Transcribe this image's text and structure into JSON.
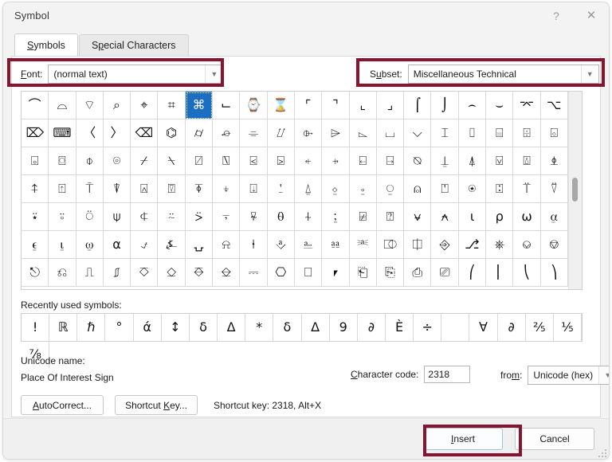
{
  "window": {
    "title": "Symbol",
    "help_icon": "question-mark-icon",
    "close_icon": "close-x-icon"
  },
  "tabs": [
    {
      "label": "Symbols",
      "accel": "S",
      "active": true
    },
    {
      "label": "Special Characters",
      "accel": "p",
      "active": false
    }
  ],
  "font_selector": {
    "label": "Font:",
    "accel": "F",
    "value": "(normal text)",
    "arrow_icon": "chevron-down-icon",
    "highlighted": true
  },
  "subset_selector": {
    "label": "Subset:",
    "accel": "u",
    "value": "Miscellaneous Technical",
    "arrow_icon": "chevron-down-icon",
    "highlighted": true
  },
  "symbol_grid": {
    "columns": 20,
    "rows": 7,
    "selected_index": 6,
    "selected_char": "⌘",
    "cells": [
      "⌒",
      "⌓",
      "⌔",
      "⌕",
      "⌖",
      "⌗",
      "⌘",
      "⌙",
      "⌚",
      "⌛",
      "⌜",
      "⌝",
      "⌞",
      "⌟",
      "⌠",
      "⌡",
      "⌢",
      "⌣",
      "⌤",
      "⌥",
      "⌦",
      "⌨",
      "〈",
      "〉",
      "⌫",
      "⌬",
      "⌭",
      "⌮",
      "⌯",
      "⌰",
      "⌱",
      "⌲",
      "⌳",
      "⌴",
      "⌵",
      "⌶",
      "⌷",
      "⌸",
      "⌹",
      "⌺",
      "⌻",
      "⌼",
      "⌽",
      "⌾",
      "⌿",
      "⍀",
      "⍁",
      "⍂",
      "⍃",
      "⍄",
      "⍅",
      "⍆",
      "⍇",
      "⍈",
      "⍉",
      "⍊",
      "⍋",
      "⍌",
      "⍍",
      "⍎",
      "⍏",
      "⍐",
      "⍑",
      "⍒",
      "⍓",
      "⍔",
      "⍕",
      "⍖",
      "⍗",
      "⍘",
      "⍙",
      "⍚",
      "⍛",
      "⍜",
      "⍝",
      "⍞",
      "⍟",
      "⍠",
      "⍡",
      "⍢",
      "⍣",
      "⍤",
      "⍥",
      "⍦",
      "⍧",
      "⍨",
      "⍩",
      "⍪",
      "⍫",
      "⍬",
      "⍭",
      "⍮",
      "⍯",
      "⍰",
      "⍱",
      "⍲",
      "⍳",
      "⍴",
      "⍵",
      "⍶",
      "⍷",
      "⍸",
      "⍹",
      "⍺",
      "⍻",
      "⍼",
      "⍽",
      "⍾",
      "⍿",
      "⎀",
      "⎁",
      "⎂",
      "⎃",
      "⎄",
      "⎅",
      "⎆",
      "⎇",
      "⎈",
      "⎉",
      "⎊",
      "⎋",
      "⎌",
      "⎍",
      "⎎",
      "⎏",
      "⎐",
      "⎑",
      "⎒",
      "⎓",
      "⎔",
      "⎕",
      "⎖",
      "⎗",
      "⎘",
      "⎙",
      "⎚",
      "⎛",
      "⎜",
      "⎝",
      "⎞"
    ],
    "scrollbar": {
      "visible": true,
      "thumb_position": "middle"
    }
  },
  "recently_used": {
    "label": "Recently used symbols:",
    "symbols": [
      "!",
      "ℝ",
      "ℏ",
      "°",
      "ά",
      "↕",
      "δ",
      "Δ",
      "*",
      "δ",
      "Δ",
      "9",
      "∂",
      "È",
      "÷",
      " ",
      "∀",
      "∂",
      "⅖",
      "⅕",
      "⅞"
    ]
  },
  "unicode_info": {
    "name_label": "Unicode name:",
    "name_value": "Place Of Interest Sign"
  },
  "character_code": {
    "label": "Character code:",
    "accel": "C",
    "value": "2318"
  },
  "from_field": {
    "label": "from:",
    "accel": "m",
    "value": "Unicode (hex)",
    "arrow_icon": "chevron-down-icon"
  },
  "action_buttons": {
    "autocorrect": "AutoCorrect...",
    "autocorrect_accel": "A",
    "shortcut_key": "Shortcut Key...",
    "shortcut_key_accel": "K",
    "shortcut_text": "Shortcut key: 2318, Alt+X"
  },
  "footer": {
    "insert": "Insert",
    "insert_accel": "I",
    "insert_highlighted": true,
    "cancel": "Cancel"
  },
  "colors": {
    "annotation": "#8a142f",
    "selection": "#1b6ec2",
    "window_bg": "#f3f3f3",
    "panel_bg": "#ffffff"
  }
}
